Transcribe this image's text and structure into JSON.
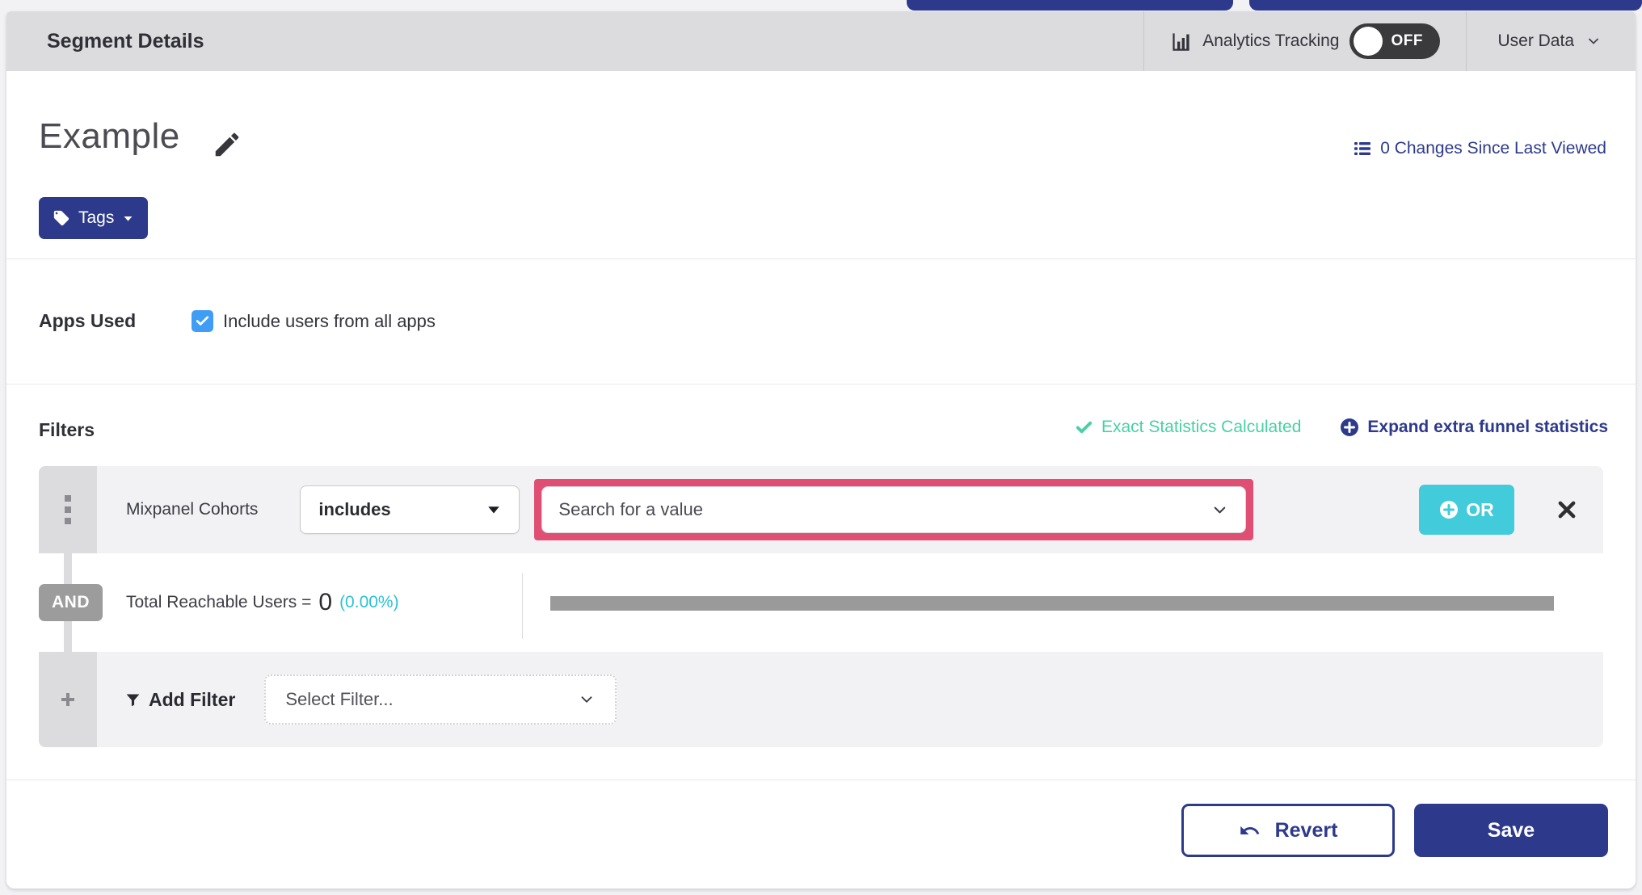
{
  "header": {
    "title": "Segment Details",
    "analytics_tracking_label": "Analytics Tracking",
    "toggle_state": "OFF",
    "user_data_label": "User Data"
  },
  "segment": {
    "name": "Example",
    "tags_button_label": "Tags",
    "changes_link_label": "0 Changes Since Last Viewed"
  },
  "apps_used": {
    "label": "Apps Used",
    "checkbox_label": "Include users from all apps",
    "checked": true
  },
  "filters": {
    "title": "Filters",
    "exact_stats_label": "Exact Statistics Calculated",
    "expand_link_label": "Expand extra funnel statistics",
    "filter_row": {
      "field_label": "Mixpanel Cohorts",
      "operator_value": "includes",
      "value_placeholder": "Search for a value",
      "or_button_label": "OR"
    },
    "and_row": {
      "badge_label": "AND",
      "stats_prefix": "Total Reachable Users =",
      "stats_value": "0",
      "stats_percent": "(0.00%)"
    },
    "add_filter": {
      "label": "Add Filter",
      "select_placeholder": "Select Filter..."
    }
  },
  "footer": {
    "revert_label": "Revert",
    "save_label": "Save"
  },
  "icons": {
    "header_analytics": "bar-chart-icon",
    "user_data": "chevron-down-icon",
    "segment_edit": "pencil-icon",
    "tags": "tag-icon",
    "tags_caret": "caret-down-icon",
    "changes": "list-icon",
    "exact_stats": "check-icon",
    "expand": "plus-circle-icon",
    "filter_drag": "grip-dots-icon",
    "operator_caret": "caret-down-icon",
    "value_chevron": "chevron-down-icon",
    "or_plus": "plus-circle-icon",
    "remove": "x-icon",
    "add_handle": "plus-icon",
    "add_filter": "funnel-icon",
    "revert": "undo-icon"
  },
  "colors": {
    "brand_indigo": "#2d3a8c",
    "teal_button": "#41cbdb",
    "teal_text": "#2bc2d6",
    "success_green": "#48d0a4",
    "highlight_pink": "#e04f73",
    "toggle_dark": "#3a3a3d",
    "checkbox_blue": "#3f9df5",
    "neutral_gray": "#9c9c9c",
    "header_gray": "#dcdcdf"
  }
}
